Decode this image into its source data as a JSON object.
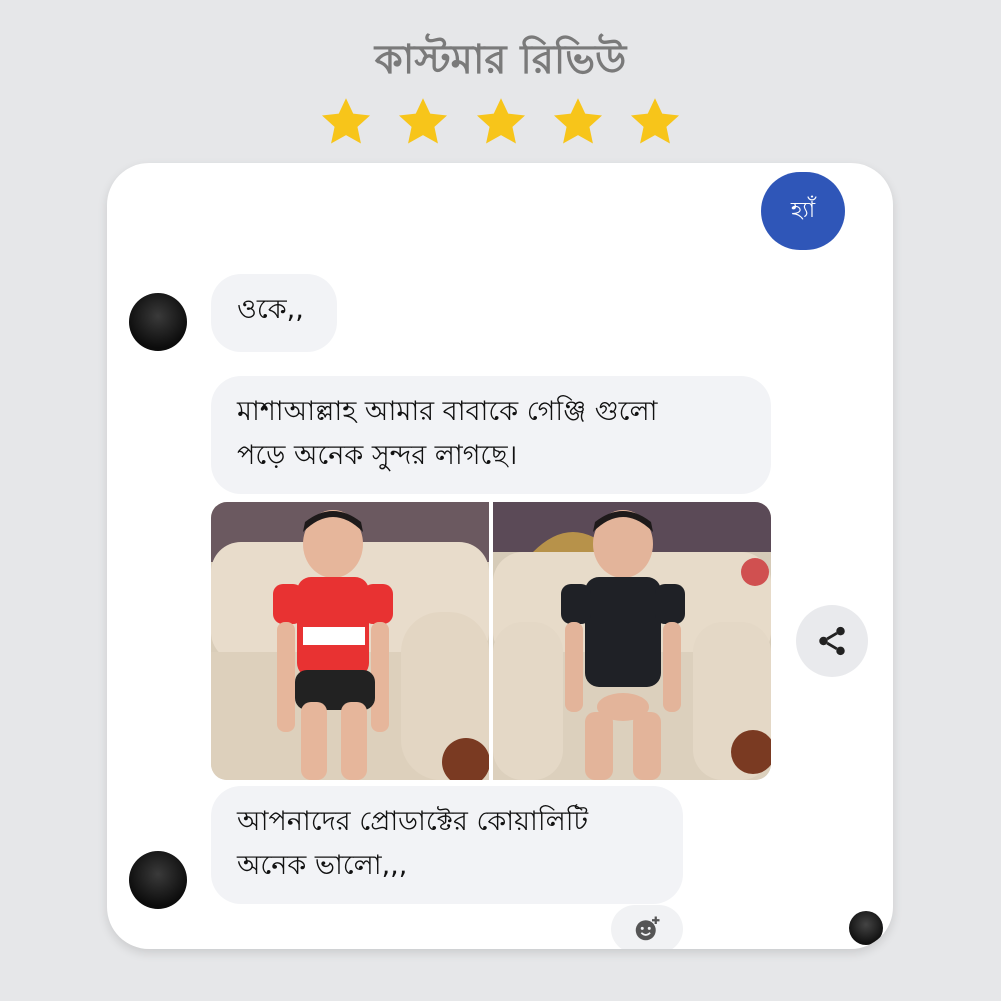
{
  "header": {
    "title": "কাস্টমার রিভিউ",
    "rating": 5,
    "star_color": "#f7c51a"
  },
  "chat": {
    "sent_message": "হ্যাঁ",
    "sent_color": "#2f56b8",
    "messages": [
      {
        "lines": [
          "ওকে,,"
        ]
      },
      {
        "lines": [
          "মাশাআল্লাহ আমার বাবাকে গেঞ্জি গুলো",
          "পড়ে অনেক সুন্দর লাগছে।"
        ]
      },
      {
        "lines": [
          "আপনাদের প্রোডাক্টের কোয়ালিটি",
          "অনেক ভালো,,,"
        ]
      }
    ],
    "share_icon": "share-icon",
    "reaction_icon": "add-reaction-icon"
  }
}
